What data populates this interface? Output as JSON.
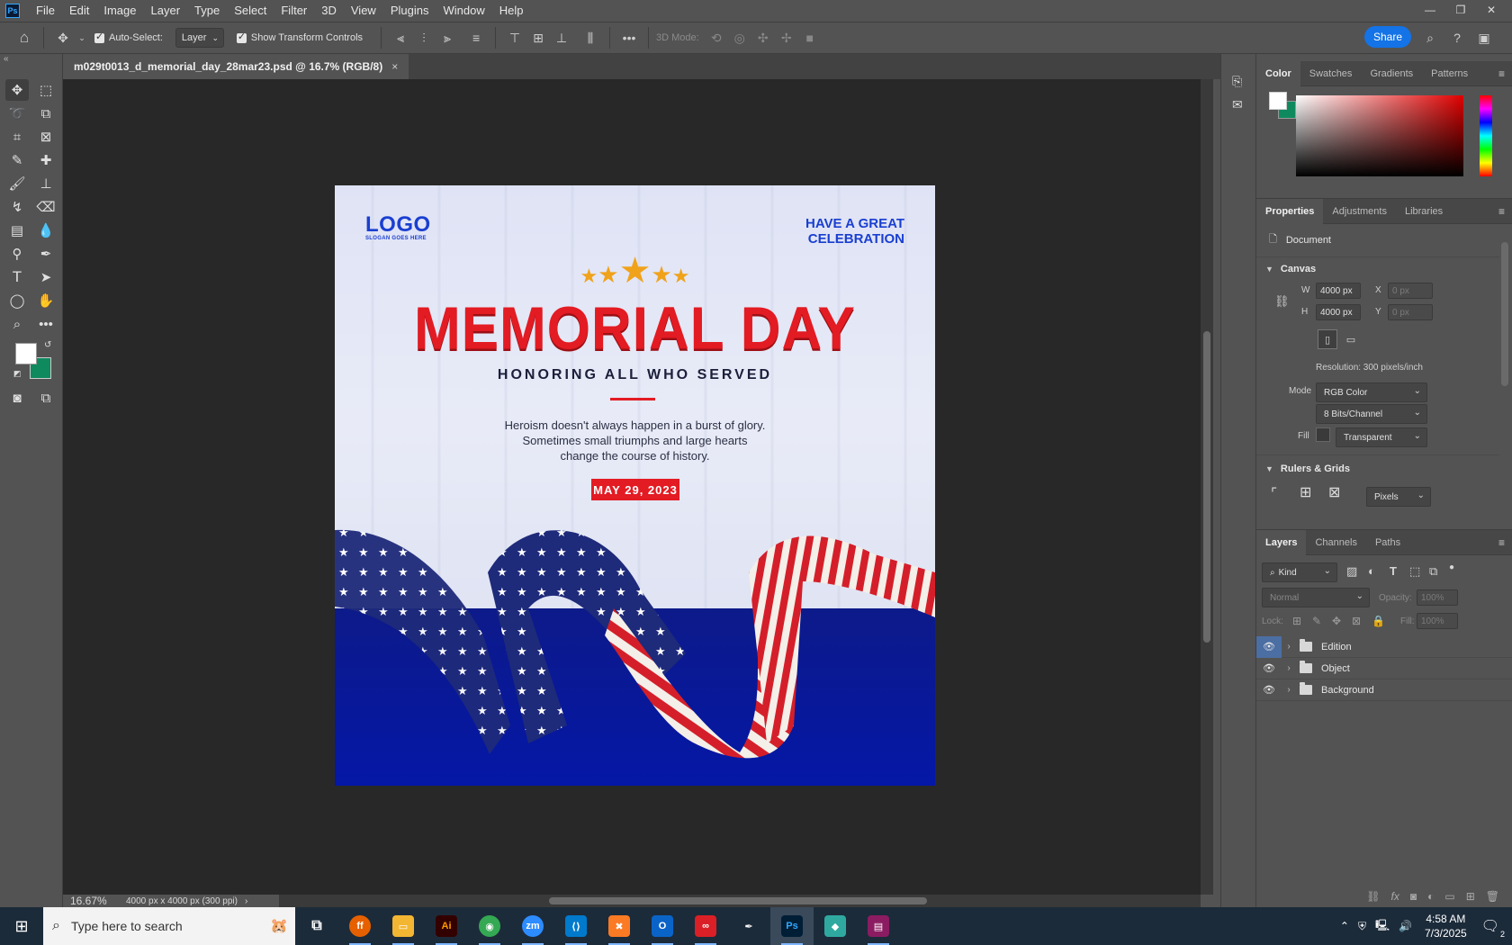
{
  "menubar": {
    "logo": "Ps",
    "items": [
      "File",
      "Edit",
      "Image",
      "Layer",
      "Type",
      "Select",
      "Filter",
      "3D",
      "View",
      "Plugins",
      "Window",
      "Help"
    ]
  },
  "options": {
    "auto_select_label": "Auto-Select:",
    "auto_select_target": "Layer",
    "transform_label": "Show Transform Controls",
    "mode_3d": "3D Mode:",
    "share": "Share"
  },
  "document": {
    "tab_title": "m029t0013_d_memorial_day_28mar23.psd @ 16.7% (RGB/8)",
    "zoom": "16.67%",
    "dims": "4000 px x 4000 px (300 ppi)"
  },
  "artwork": {
    "logo": "LOGO",
    "slogan": "SLOGAN GOES HERE",
    "celebrate_line1": "HAVE A GREAT",
    "celebrate_line2": "CELEBRATION",
    "title": "MEMORIAL DAY",
    "subtitle": "HONORING ALL WHO SERVED",
    "body1": "Heroism doesn't always happen in a burst of glory.",
    "body2": "Sometimes small triumphs and large hearts",
    "body3": "change the course of history.",
    "date": "MAY 29, 2023"
  },
  "color_panel": {
    "tabs": [
      "Color",
      "Swatches",
      "Gradients",
      "Patterns"
    ],
    "foreground": "#ffffff",
    "background": "#0f8a5f"
  },
  "properties_panel": {
    "tabs": [
      "Properties",
      "Adjustments",
      "Libraries"
    ],
    "doc_label": "Document",
    "canvas_section": "Canvas",
    "w_label": "W",
    "w_value": "4000 px",
    "h_label": "H",
    "h_value": "4000 px",
    "x_label": "X",
    "x_placeholder": "0 px",
    "y_label": "Y",
    "y_placeholder": "0 px",
    "resolution": "Resolution: 300 pixels/inch",
    "mode_label": "Mode",
    "mode_value": "RGB Color",
    "bits_value": "8 Bits/Channel",
    "fill_label": "Fill",
    "fill_value": "Transparent",
    "rulers_section": "Rulers & Grids",
    "units_value": "Pixels"
  },
  "layers_panel": {
    "tabs": [
      "Layers",
      "Channels",
      "Paths"
    ],
    "kind": "Kind",
    "blend": "Normal",
    "opacity_label": "Opacity:",
    "opacity_value": "100%",
    "lock_label": "Lock:",
    "fill_label": "Fill:",
    "fill_value": "100%",
    "layers": [
      {
        "name": "Edition"
      },
      {
        "name": "Object"
      },
      {
        "name": "Background"
      }
    ]
  },
  "taskbar": {
    "search_placeholder": "Type here to search",
    "apps": [
      "Firefox",
      "File Explorer",
      "Illustrator",
      "Chrome",
      "Zoom",
      "VS Code",
      "XAMPP",
      "Outlook",
      "Creative Cloud",
      "Pen tool",
      "Photoshop",
      "App",
      "WinRAR"
    ],
    "time": "4:58 AM",
    "date": "7/3/2025",
    "notif_count": "2"
  }
}
